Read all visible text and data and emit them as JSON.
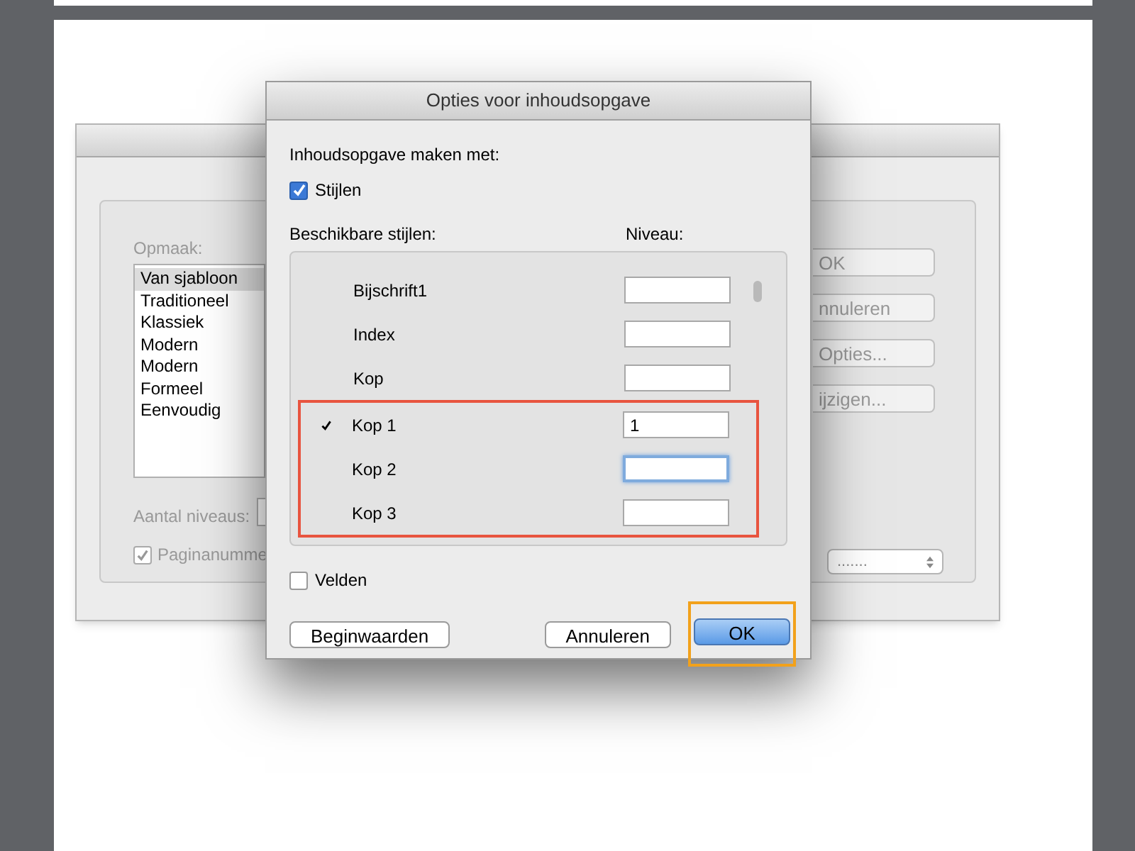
{
  "back_dialog": {
    "disabled": true,
    "format_label": "Opmaak:",
    "formats": [
      {
        "label": "Van sjabloon",
        "selected": true
      },
      {
        "label": "Traditioneel",
        "selected": false
      },
      {
        "label": "Klassiek",
        "selected": false
      },
      {
        "label": "Modern",
        "selected": false
      },
      {
        "label": "Modern",
        "selected": false
      },
      {
        "label": "Formeel",
        "selected": false
      },
      {
        "label": "Eenvoudig",
        "selected": false
      }
    ],
    "levels_label": "Aantal niveaus:",
    "page_numbers": {
      "label": "Paginanumme",
      "checked": true
    },
    "buttons": [
      "OK",
      "nnuleren",
      "Opties...",
      "ijzigen..."
    ],
    "select": {
      "value": "......."
    }
  },
  "dialog": {
    "title": "Opties voor inhoudsopgave",
    "build_label": "Inhoudsopgave maken met:",
    "styles_checkbox": {
      "label": "Stijlen",
      "checked": true
    },
    "styles_heading": "Beschikbare stijlen:",
    "level_heading": "Niveau:",
    "styles": [
      {
        "name": "Bijschrift1",
        "checked": false,
        "focused": false,
        "highlighted": false
      },
      {
        "name": "Index",
        "checked": false,
        "focused": false,
        "highlighted": false
      },
      {
        "name": "Kop",
        "checked": false,
        "focused": false,
        "highlighted": false
      },
      {
        "name": "Kop 1",
        "checked": true,
        "level": "1",
        "focused": false,
        "highlighted": true
      },
      {
        "name": "Kop 2",
        "checked": false,
        "focused": true,
        "highlighted": true
      },
      {
        "name": "Kop 3",
        "checked": false,
        "focused": false,
        "highlighted": true
      }
    ],
    "fields_checkbox": {
      "label": "Velden",
      "checked": false
    },
    "buttons": [
      {
        "label": "Beginwaarden",
        "default": false,
        "highlighted": false
      },
      {
        "label": "Annuleren",
        "default": false,
        "highlighted": false
      },
      {
        "label": "OK",
        "default": true,
        "highlighted": true
      }
    ]
  }
}
